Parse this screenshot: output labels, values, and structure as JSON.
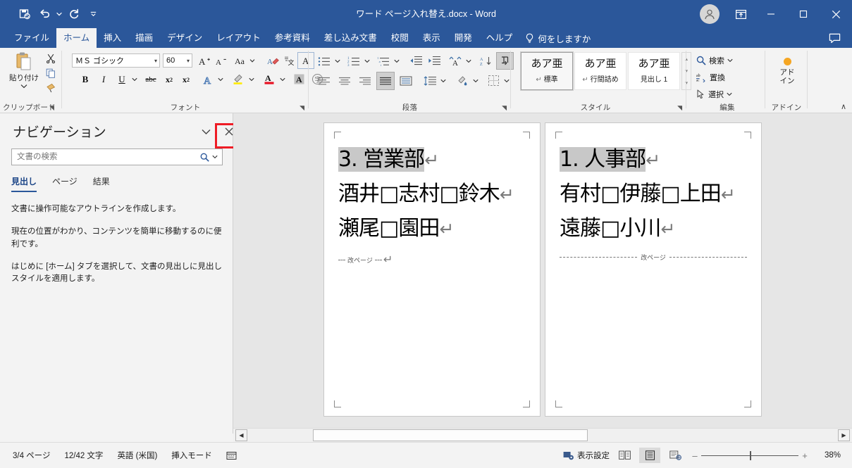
{
  "window": {
    "title": "ワード ページ入れ替え.docx  -  Word",
    "accent_color": "#2b579a",
    "minimize_label": "–",
    "maximize_label": "□",
    "close_label": "✕"
  },
  "quick_access": {
    "items": [
      {
        "name": "autosave-save-icon",
        "label": "上書き保存"
      },
      {
        "name": "undo-icon",
        "label": "元に戻す"
      },
      {
        "name": "undo-dropdown-icon",
        "label": "元に戻す履歴"
      },
      {
        "name": "redo-icon",
        "label": "繰り返し"
      },
      {
        "name": "customize-qat-icon",
        "label": "クイック アクセス ツール バーのユーザー設定"
      }
    ]
  },
  "tabs": [
    {
      "label": "ファイル",
      "active": false
    },
    {
      "label": "ホーム",
      "active": true
    },
    {
      "label": "挿入",
      "active": false
    },
    {
      "label": "描画",
      "active": false
    },
    {
      "label": "デザイン",
      "active": false
    },
    {
      "label": "レイアウト",
      "active": false
    },
    {
      "label": "参考資料",
      "active": false
    },
    {
      "label": "差し込み文書",
      "active": false
    },
    {
      "label": "校閲",
      "active": false
    },
    {
      "label": "表示",
      "active": false
    },
    {
      "label": "開発",
      "active": false
    },
    {
      "label": "ヘルプ",
      "active": false
    }
  ],
  "tell_me": {
    "label": "何をしますか",
    "icon": "lightbulb-icon"
  },
  "ribbon": {
    "groups": {
      "clipboard": {
        "label": "クリップボード",
        "paste_label": "貼り付け"
      },
      "font": {
        "label": "フォント",
        "font_name": "ＭＳ ゴシック",
        "font_size": "60"
      },
      "paragraph": {
        "label": "段落"
      },
      "styles": {
        "label": "スタイル",
        "gallery": [
          {
            "preview": "あア亜",
            "name": "標準",
            "selected": true
          },
          {
            "preview": "あア亜",
            "name": "行間詰め",
            "selected": false
          },
          {
            "preview": "あア亜",
            "name": "見出し 1",
            "selected": false
          }
        ]
      },
      "editing": {
        "label": "編集",
        "items": [
          {
            "label": "検索",
            "icon": "search-icon",
            "has_caret": true
          },
          {
            "label": "置換",
            "icon": "replace-icon",
            "has_caret": false
          },
          {
            "label": "選択",
            "icon": "select-cursor-icon",
            "has_caret": true
          }
        ]
      },
      "addins": {
        "label": "アドイン",
        "button_line1": "アド",
        "button_line2": "イン"
      }
    },
    "collapse_label": "∧"
  },
  "navigation": {
    "title": "ナビゲーション",
    "search_placeholder": "文書の検索",
    "search_value": "",
    "tabs": [
      {
        "label": "見出し",
        "active": true
      },
      {
        "label": "ページ",
        "active": false
      },
      {
        "label": "結果",
        "active": false
      }
    ],
    "body": [
      "文書に操作可能なアウトラインを作成します。",
      "現在の位置がわかり、コンテンツを簡単に移動するのに便利です。",
      "はじめに [ホーム] タブを選択して、文書の見出しに見出しスタイルを適用します。"
    ],
    "highlight_color": "#ee1c25"
  },
  "document": {
    "pages": [
      {
        "lines": [
          {
            "text": "3. 営業部",
            "highlighted": true,
            "squares": [],
            "pilcrow": "↵"
          },
          {
            "text": "酒井□志村□鈴木",
            "highlighted": false,
            "pilcrow": "↵"
          },
          {
            "text": "瀬尾□園田",
            "highlighted": false,
            "pilcrow": "↵"
          }
        ],
        "page_break_label": "改ページ",
        "page_break_pilcrow": "↵"
      },
      {
        "lines": [
          {
            "text": "1. 人事部",
            "highlighted": true,
            "squares": [],
            "pilcrow": "↵"
          },
          {
            "text": "有村□伊藤□上田",
            "highlighted": false,
            "pilcrow": "↵"
          },
          {
            "text": "遠藤□小川",
            "highlighted": false,
            "pilcrow": "↵"
          }
        ],
        "page_break_label": "改ページ",
        "page_break_pilcrow": ""
      }
    ]
  },
  "status_bar": {
    "page_info": "3/4 ページ",
    "word_count": "12/42 文字",
    "language": "英語 (米国)",
    "mode": "挿入モード",
    "proofing_icon": "proofing-icon",
    "display_settings": "表示設定",
    "views": [
      {
        "name": "read-mode-icon",
        "active": false
      },
      {
        "name": "print-layout-icon",
        "active": true
      },
      {
        "name": "web-layout-icon",
        "active": false
      }
    ],
    "zoom_out": "–",
    "zoom_in": "+",
    "zoom_level": "38%"
  }
}
